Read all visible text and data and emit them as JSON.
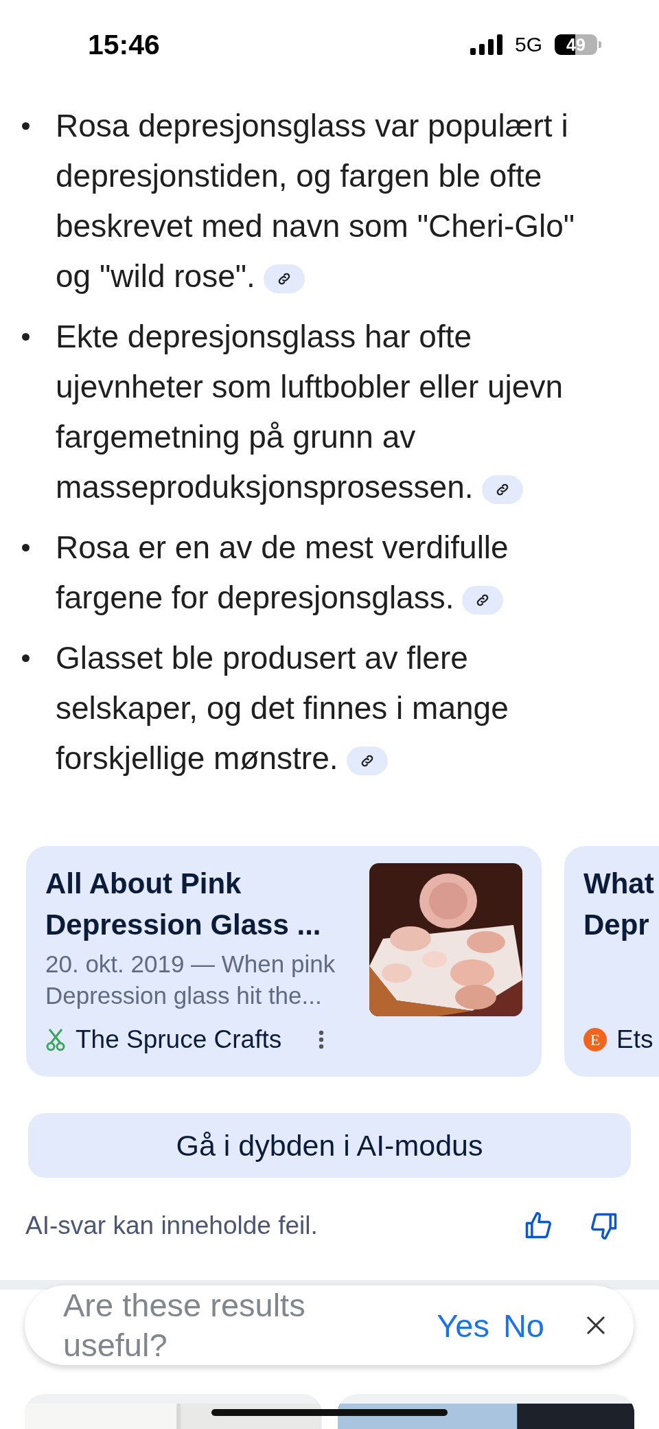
{
  "status_bar": {
    "time": "15:46",
    "network": "5G",
    "battery": "49"
  },
  "bullets": [
    {
      "text": "Rosa depresjonsglass var populært i depresjonstiden, og fargen ble ofte beskrevet med navn som \"Cheri-Glo\" og \"wild rose\"."
    },
    {
      "text": "Ekte depresjonsglass har ofte ujevnheter som luftbobler eller ujevn fargemetning på grunn av masseproduksjonsprosessen."
    },
    {
      "text": "Rosa er en av de mest verdifulle fargene for depresjonsglass."
    },
    {
      "text": "Glasset ble produsert av flere selskaper, og det finnes i mange forskjellige mønstre."
    }
  ],
  "cards": [
    {
      "title_lines": [
        "All About Pink",
        "Depression Glass ..."
      ],
      "snippet": "20. okt. 2019 — When pink Depression glass hit the...",
      "source": "The Spruce Crafts",
      "source_icon": {
        "kind": "scissors"
      },
      "menu": true
    },
    {
      "title_lines": [
        "What",
        "Depr"
      ],
      "source": "Ets",
      "source_icon": {
        "kind": "letter",
        "text": "E"
      },
      "menu": false
    }
  ],
  "ai_button": "Gå i dybden i AI-modus",
  "disclaimer": "AI-svar kan inneholde feil.",
  "feedback": {
    "question": "Are these results useful?",
    "yes": "Yes",
    "no": "No"
  }
}
